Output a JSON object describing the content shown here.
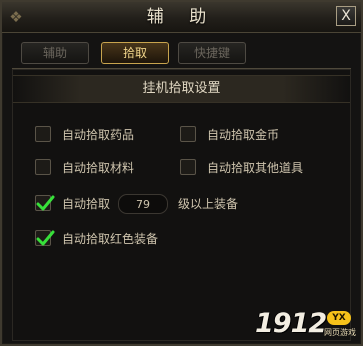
{
  "window": {
    "title": "辅 助",
    "close_label": "X"
  },
  "tabs": [
    {
      "label": "辅助",
      "active": false
    },
    {
      "label": "拾取",
      "active": true
    },
    {
      "label": "快捷键",
      "active": false
    }
  ],
  "section": {
    "title": "挂机拾取设置"
  },
  "options": [
    {
      "label": "自动拾取药品",
      "checked": false
    },
    {
      "label": "自动拾取金币",
      "checked": false
    },
    {
      "label": "自动拾取材料",
      "checked": false
    },
    {
      "label": "自动拾取其他道具",
      "checked": false
    },
    {
      "label_before": "自动拾取",
      "level_value": "79",
      "label_after": "级以上装备",
      "checked": true
    },
    {
      "label": "自动拾取红色装备",
      "checked": true
    }
  ],
  "watermark": {
    "digits": "1912",
    "badge": "YX",
    "subtitle": "网页游戏"
  },
  "colors": {
    "check_mark": "#37e03a",
    "active_tab_border": "#c8a44e",
    "active_tab_text": "#f0d48a"
  }
}
